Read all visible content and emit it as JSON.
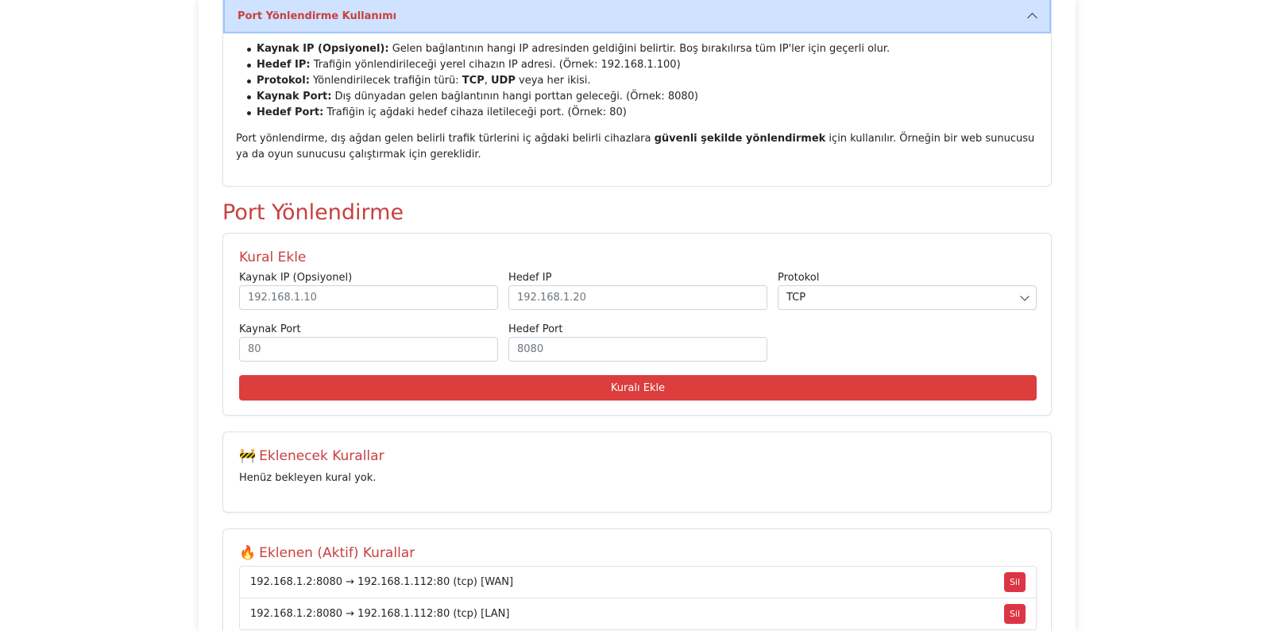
{
  "accordion": {
    "title": "Port Yönlendirme Kullanımı",
    "items": [
      {
        "term": "Kaynak IP (Opsiyonel):",
        "desc": " Gelen bağlantının hangi IP adresinden geldiğini belirtir. Boş bırakılırsa tüm IP'ler için geçerli olur."
      },
      {
        "term": "Hedef IP:",
        "desc": " Trafiğin yönlendirileceği yerel cihazın IP adresi. (Örnek: 192.168.1.100)"
      },
      {
        "term": "Protokol:",
        "desc_pre": " Yönlendirilecek trafiğin türü: ",
        "tcp": "TCP",
        "sep": ", ",
        "udp": "UDP",
        "desc_post": " veya her ikisi."
      },
      {
        "term": "Kaynak Port:",
        "desc": " Dış dünyadan gelen bağlantının hangi porttan geleceği. (Örnek: 8080)"
      },
      {
        "term": "Hedef Port:",
        "desc": " Trafiğin iç ağdaki hedef cihaza iletileceği port. (Örnek: 80)"
      }
    ],
    "para_pre": "Port yönlendirme, dış ağdan gelen belirli trafik türlerini iç ağdaki belirli cihazlara ",
    "para_bold": "güvenli şekilde yönlendirmek",
    "para_post": " için kullanılır. Örneğin bir web sunucusu ya da oyun sunucusu çalıştırmak için gereklidir."
  },
  "section_title": "Port Yönlendirme",
  "form": {
    "title": "Kural Ekle",
    "source_ip_label": "Kaynak IP (Opsiyonel)",
    "source_ip_placeholder": "192.168.1.10",
    "dest_ip_label": "Hedef IP",
    "dest_ip_placeholder": "192.168.1.20",
    "protocol_label": "Protokol",
    "protocol_value": "TCP",
    "source_port_label": "Kaynak Port",
    "source_port_placeholder": "80",
    "dest_port_label": "Hedef Port",
    "dest_port_placeholder": "8080",
    "submit_label": "Kuralı Ekle"
  },
  "pending": {
    "emoji": "🚧",
    "title": "Eklenecek Kurallar",
    "empty_text": "Henüz bekleyen kural yok."
  },
  "active": {
    "emoji": "🔥",
    "title": "Eklenen (Aktif) Kurallar",
    "rules": [
      {
        "text": "192.168.1.2:8080 → 192.168.1.112:80 (tcp) [WAN]",
        "delete_label": "Sil"
      },
      {
        "text": "192.168.1.2:8080 → 192.168.1.112:80 (tcp) [LAN]",
        "delete_label": "Sil"
      }
    ]
  }
}
